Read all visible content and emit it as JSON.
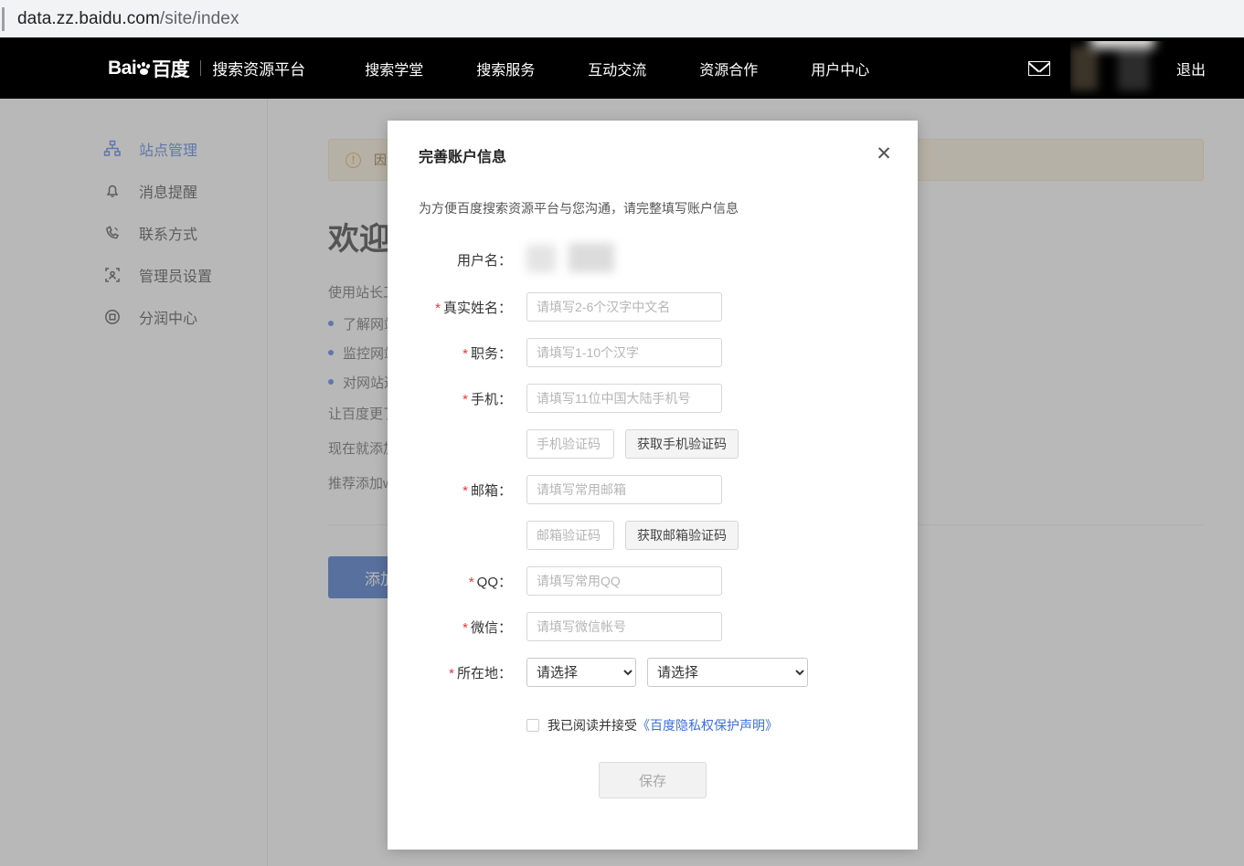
{
  "browser": {
    "url_main": "data.zz.baidu.com",
    "url_path": "/site/index"
  },
  "header": {
    "logo_text": "Bai",
    "logo_text2": "百度",
    "platform_name": "搜索资源平台",
    "nav": [
      {
        "label": "搜索学堂"
      },
      {
        "label": "搜索服务"
      },
      {
        "label": "互动交流"
      },
      {
        "label": "资源合作"
      },
      {
        "label": "用户中心"
      }
    ],
    "mail_icon": "envelope-icon",
    "logout_label": "退出"
  },
  "sidebar": {
    "items": [
      {
        "label": "站点管理",
        "icon": "sitemap-icon",
        "active": true
      },
      {
        "label": "消息提醒",
        "icon": "bell-icon",
        "active": false
      },
      {
        "label": "联系方式",
        "icon": "phone-icon",
        "active": false
      },
      {
        "label": "管理员设置",
        "icon": "admin-user-icon",
        "active": false
      },
      {
        "label": "分润中心",
        "icon": "revenue-icon",
        "active": false
      }
    ]
  },
  "page": {
    "alert_icon": "warning-circle-icon",
    "alert_text": "因您的账户信息不完整，部分功能暂时无法使用，请尽快完善账户信息",
    "welcome_title": "欢迎来到百度搜索资源平台",
    "intro": "使用站长工具，您可以：",
    "bullets": [
      "了解网站在百度搜索引擎中的收录情况",
      "监控网站在百度搜索中的表现数据",
      "对网站进行优化诊断并获取改进建议"
    ],
    "para1": "让百度更了解您的网站，获得更多流量。",
    "para2": "现在就添加您的网站，开启数据之旅。",
    "para3": "推荐添加www主域名，便于数据统计与管理。",
    "primary_button": "添加网站"
  },
  "modal": {
    "title": "完善账户信息",
    "close_icon": "close-icon",
    "subtitle": "为方便百度搜索资源平台与您沟通，请完整填写账户信息",
    "fields": {
      "username_label": "用户名：",
      "realname_label": "真实姓名：",
      "realname_placeholder": "请填写2-6个汉字中文名",
      "job_label": "职务：",
      "job_placeholder": "请填写1-10个汉字",
      "phone_label": "手机：",
      "phone_placeholder": "请填写11位中国大陆手机号",
      "phone_code_placeholder": "手机验证码",
      "phone_code_button": "获取手机验证码",
      "email_label": "邮箱：",
      "email_placeholder": "请填写常用邮箱",
      "email_code_placeholder": "邮箱验证码",
      "email_code_button": "获取邮箱验证码",
      "qq_label": "QQ：",
      "qq_placeholder": "请填写常用QQ",
      "wechat_label": "微信：",
      "wechat_placeholder": "请填写微信帐号",
      "location_label": "所在地：",
      "province_selected": "请选择",
      "city_selected": "请选择"
    },
    "agreement_text": "我已阅读并接受",
    "agreement_link": "《百度隐私权保护声明》",
    "save_button": "保存",
    "required_mark": "*"
  },
  "colors": {
    "accent_blue": "#3c6fe0",
    "primary_button": "#2c5fc4",
    "required_red": "#e4393c",
    "alert_bg": "#fbf0d8",
    "nav_bg": "#000000"
  }
}
